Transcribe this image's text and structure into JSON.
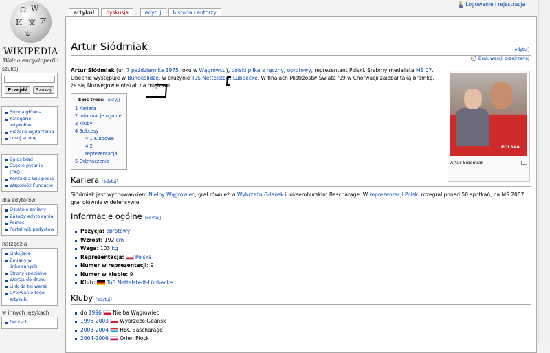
{
  "logo": {
    "wordmark": "WIKIPEDIA",
    "tagline": "Wolna encyklopedia",
    "globe_glyphs": [
      "Ω",
      "W",
      "И",
      "文",
      "ア",
      "ש"
    ]
  },
  "personal": {
    "login": "Logowanie i rejestracja",
    "icon": "user-icon"
  },
  "tabs": [
    {
      "label": "artykuł",
      "selected": true
    },
    {
      "label": "dyskusja",
      "red": true
    },
    {
      "label": "edytuj"
    },
    {
      "label": "historia i autorzy"
    }
  ],
  "sidebar": {
    "search": {
      "heading": "szukaj",
      "value": "",
      "go": "Przejdź",
      "search": "Szukaj"
    },
    "navigation": [
      "Strona główna",
      "Kategorie artykułów",
      "Bieżące wydarzenia",
      "Losuj stronę"
    ],
    "interaction": [
      "Zgłoś błąd",
      "Częste pytania (FAQ)",
      "Kontakt z Wikipedią",
      "Wspomóż Fundację"
    ],
    "editors": {
      "heading": "dla edytorów",
      "items": [
        "Ostatnie zmiany",
        "Zasady edytowania",
        "Pomoc",
        "Portal wikipedystów"
      ]
    },
    "tools": {
      "heading": "narzędzia",
      "items": [
        "Linkujące",
        "Zmiany w linkowanych",
        "Strony specjalne",
        "Wersja do druku",
        "Link do tej wersji",
        "Cytowanie tego artykułu"
      ]
    },
    "langs": {
      "heading": "w innych językach",
      "items": [
        "Deutsch"
      ]
    }
  },
  "article": {
    "title": "Artur Siódmiak",
    "edit": "edytuj",
    "nofls": "Brak wersji przejrzanej",
    "intro": {
      "name": "Artur Siódmiak",
      "t1": " (ur. ",
      "born": "7 października 1975",
      "t2": " roku w ",
      "place": "Wągrowcu",
      "t3": "), ",
      "sport": "polski piłkarz ręczny",
      "t4": ", ",
      "pos": "obrotowy",
      "t5": ", reprezentant Polski. Srebrny medalista ",
      "ms": "MŚ 07",
      "t6": ". Obecnie występuje w ",
      "league": "Bundeslidze",
      "t7": ", w drużynie ",
      "club": "TuS Nettelstedt-Lübbecke",
      "t8": ". W finałach Mistrzostw Świata '09 w Chorwacji zajebał taką bramkę, że się Norwegowie obsrali na miętowo."
    },
    "infobox": {
      "caption": "Artur Siódmiak",
      "photo_text": "POLSKA"
    },
    "toc": {
      "heading": "Spis treści",
      "toggle": "[ukryj]",
      "items": [
        {
          "label": "1 Kariera"
        },
        {
          "label": "2 Informacje ogólne"
        },
        {
          "label": "3 Kluby"
        },
        {
          "label": "4 Sukcesy"
        },
        {
          "label": "4.1 Klubowe",
          "sub": true
        },
        {
          "label": "4.2 reprezentacja",
          "sub": true
        },
        {
          "label": "5 Odznaczenia"
        }
      ]
    },
    "kariera": {
      "heading": "Kariera",
      "edit": "edytuj",
      "p1": "Siódmiak jest wychowankiem ",
      "l1": "Nielby Wągrowiec",
      "p2": ", grał również w ",
      "l2": "Wybrzeżu Gdańsk",
      "p3": " i luksemburskim Bascharage. W ",
      "l3": "reprezentacji Polski",
      "p4": " rozegrał ponad 50 spotkań, na MŚ 2007 grał głównie w defensywie."
    },
    "info": {
      "heading": "Informacje ogólne",
      "edit": "edytuj",
      "position": {
        "label": "Pozycja:",
        "value": "obrotowy"
      },
      "height": {
        "label": "Wzrost:",
        "value": "192 ",
        "unit": "cm"
      },
      "weight": {
        "label": "Waga:",
        "value": "103 ",
        "unit": "kg"
      },
      "rep": {
        "label": "Reprezentacja:",
        "value": "Polska"
      },
      "repnum": {
        "label": "Numer w reprezentacji:",
        "value": "9"
      },
      "clubnum": {
        "label": "Numer w klubie:",
        "value": "9"
      },
      "club": {
        "label": "Klub:",
        "value": "TuS Nettelstedt-Lübbecke"
      }
    },
    "kluby": {
      "heading": "Kluby",
      "edit": "edytuj",
      "rows": [
        {
          "pre": "do ",
          "years": "1996",
          "club": "Nielba Wągrowiec",
          "flag": "pl"
        },
        {
          "pre": "",
          "years": "1996-2003",
          "club": "Wybrzeże Gdańsk",
          "flag": "pl"
        },
        {
          "pre": "",
          "years": "2003-2004",
          "club": "HBC Bascharage",
          "flag": "lu"
        },
        {
          "pre": "",
          "years": "2004-2006",
          "club": "Orlen Płock",
          "flag": "pl"
        }
      ]
    }
  }
}
